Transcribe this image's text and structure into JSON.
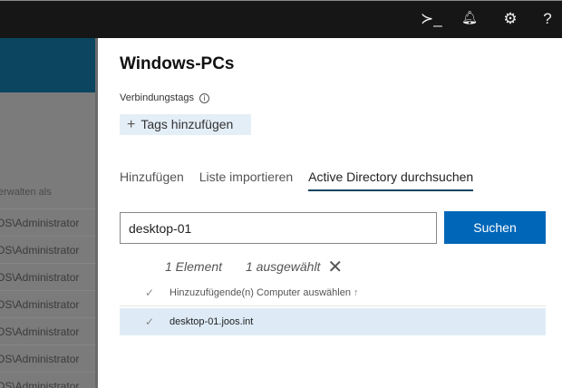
{
  "topbar": {
    "icons": [
      "terminal-icon",
      "bell-icon",
      "gear-icon",
      "help-icon"
    ],
    "terminal": "≻_",
    "bell": "🔔︎",
    "gear": "⚙",
    "help": "?"
  },
  "background_panel": {
    "column_header": "erwalten als",
    "rows": [
      "OS\\Administrator",
      "OS\\Administrator",
      "OS\\Administrator",
      "OS\\Administrator",
      "OS\\Administrator",
      "OS\\Administrator",
      "OS\\Administrator"
    ]
  },
  "panel": {
    "title": "Windows-PCs",
    "tags_label": "Verbindungstags",
    "add_tags": "Tags hinzufügen",
    "tabs": [
      {
        "label": "Hinzufügen"
      },
      {
        "label": "Liste importieren"
      },
      {
        "label": "Active Directory durchsuchen",
        "active": true
      }
    ],
    "search": {
      "value": "desktop-01"
    },
    "search_button": "Suchen",
    "count": "1 Element",
    "selected": "1 ausgewählt",
    "list_header": "Hinzuzufügende(n) Computer auswählen",
    "items": [
      {
        "name": "desktop-01.joos.int",
        "selected": true
      }
    ]
  },
  "colors": {
    "accent": "#0067b8",
    "header": "#0c4560",
    "selection": "#deebf7"
  }
}
